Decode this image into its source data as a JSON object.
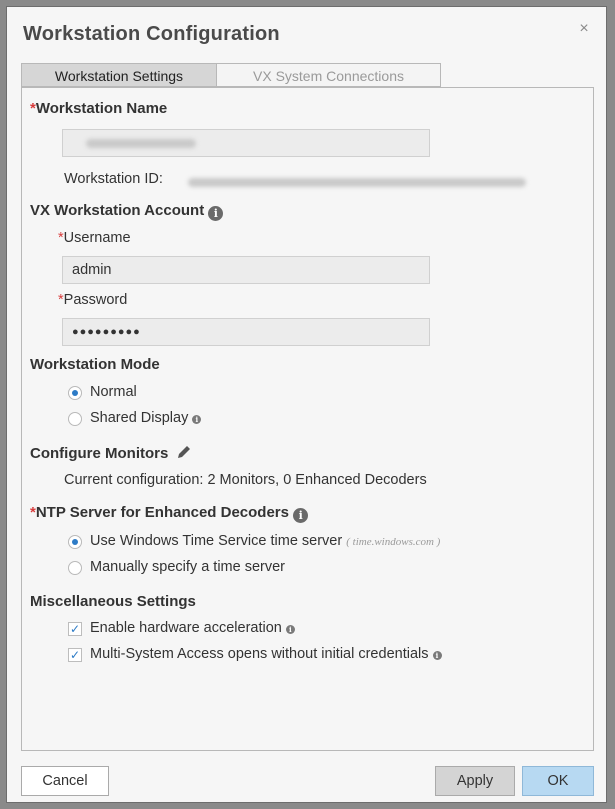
{
  "dialog": {
    "title": "Workstation Configuration",
    "close_glyph": "×",
    "tabs": [
      {
        "label": "Workstation Settings"
      },
      {
        "label": "VX System Connections"
      }
    ]
  },
  "workstation": {
    "name_label": "Workstation Name",
    "id_label": "Workstation ID:"
  },
  "account": {
    "heading": "VX Workstation Account",
    "username_label": "Username",
    "username_value": "admin",
    "password_label": "Password",
    "password_value": "●●●●●●●●●"
  },
  "mode": {
    "heading": "Workstation Mode",
    "options": [
      {
        "label": "Normal",
        "selected": true
      },
      {
        "label": "Shared Display",
        "selected": false
      }
    ]
  },
  "monitors": {
    "heading": "Configure Monitors",
    "current": "Current configuration: 2 Monitors, 0 Enhanced Decoders"
  },
  "ntp": {
    "heading": "NTP Server for Enhanced Decoders",
    "option_windows": "Use Windows Time Service time server",
    "windows_hint": "( time.windows.com )",
    "option_manual": "Manually specify a time server"
  },
  "misc": {
    "heading": "Miscellaneous Settings",
    "hw_accel": "Enable hardware acceleration",
    "multi_system": "Multi-System Access opens without initial credentials"
  },
  "buttons": {
    "cancel": "Cancel",
    "apply": "Apply",
    "ok": "OK"
  },
  "icons": {
    "required_marker": "*",
    "info": "i",
    "check": "✓",
    "pencil_color": "#555555"
  },
  "colors": {
    "accent": "#2d7bc6",
    "required": "#d83c3c",
    "ok_button": "#b7d9f2"
  }
}
